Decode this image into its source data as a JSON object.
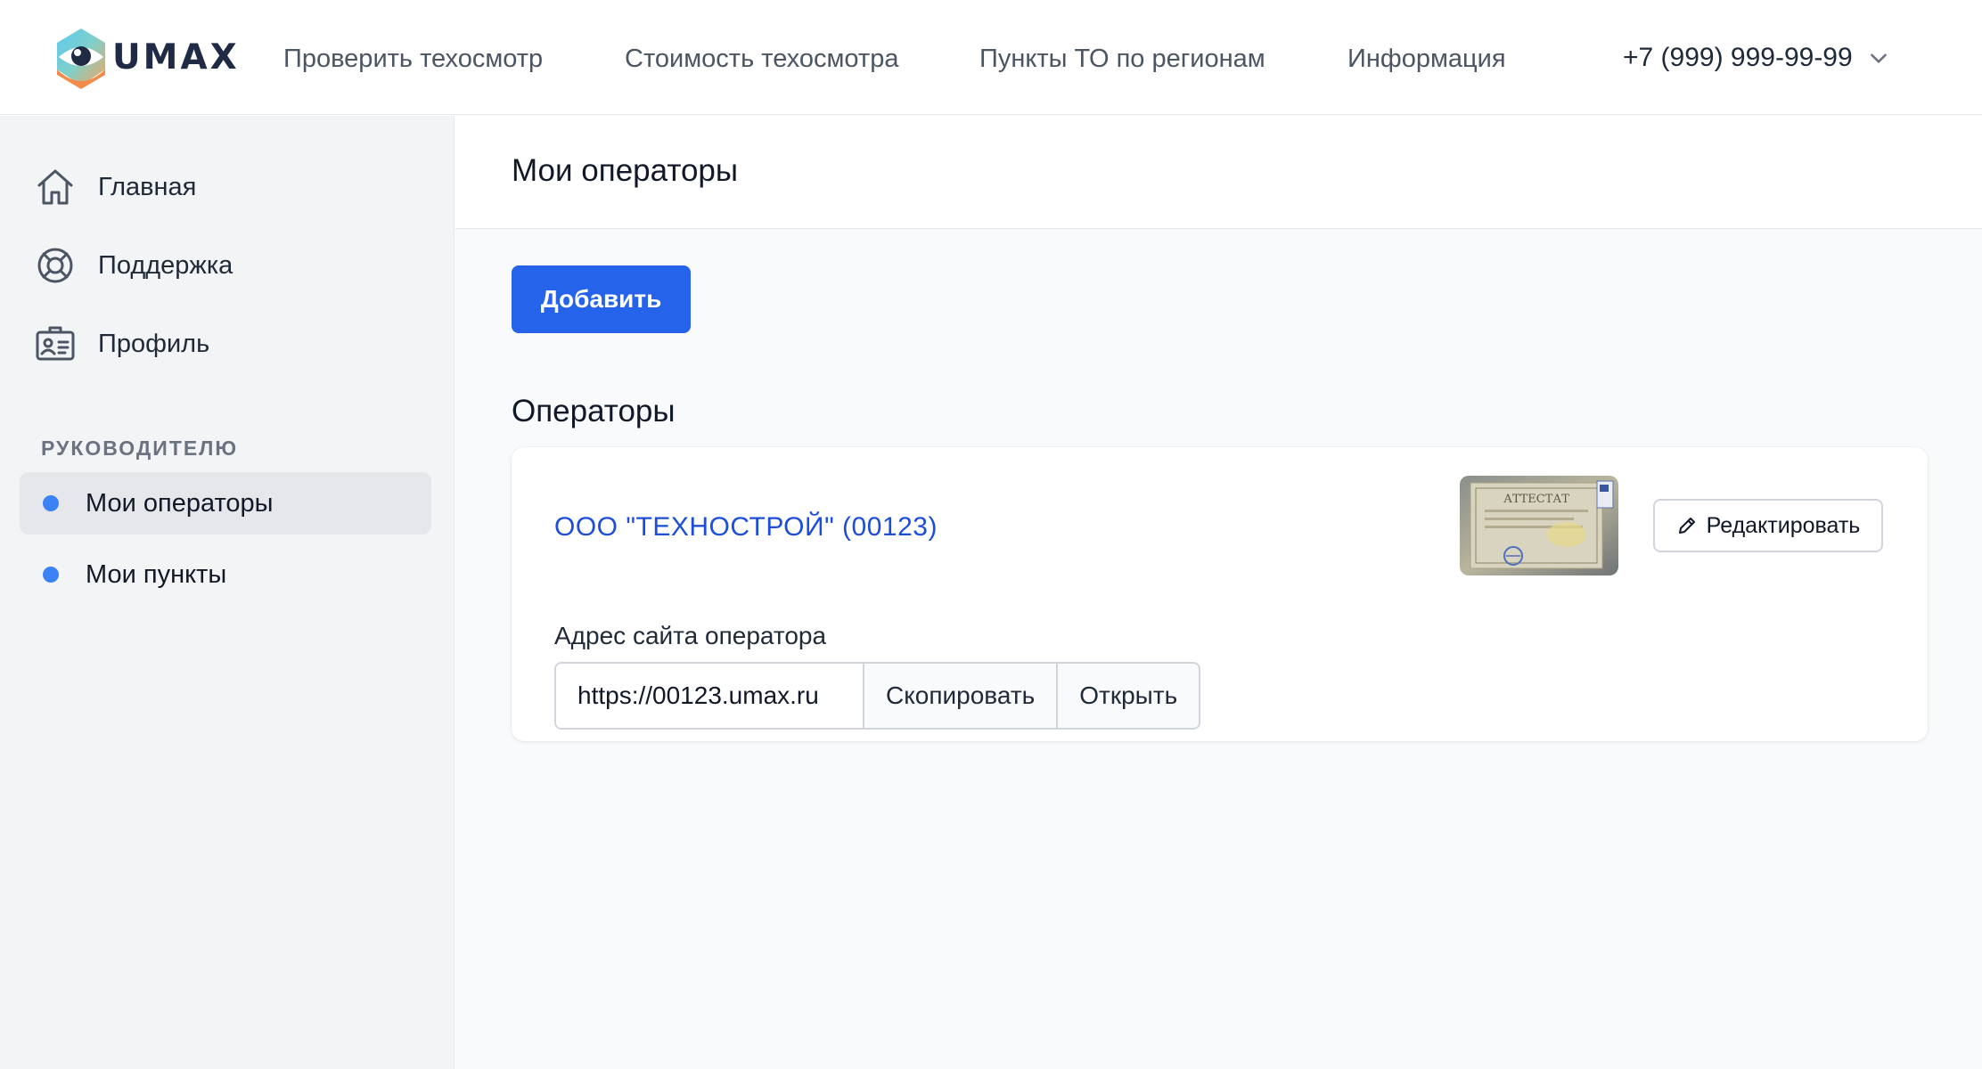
{
  "header": {
    "logo_text": "UMAX",
    "nav": [
      {
        "label": "Проверить техосмотр"
      },
      {
        "label": "Стоимость техосмотра"
      },
      {
        "label": "Пункты ТО по регионам"
      },
      {
        "label": "Информация"
      }
    ],
    "phone": "+7 (999) 999-99-99"
  },
  "sidebar": {
    "items": [
      {
        "label": "Главная",
        "icon": "home-icon"
      },
      {
        "label": "Поддержка",
        "icon": "lifebuoy-icon"
      },
      {
        "label": "Профиль",
        "icon": "id-card-icon"
      }
    ],
    "section_label": "РУКОВОДИТЕЛЮ",
    "sub_items": [
      {
        "label": "Мои операторы",
        "active": true
      },
      {
        "label": "Мои пункты",
        "active": false
      }
    ]
  },
  "main": {
    "page_title": "Мои операторы",
    "add_button": "Добавить",
    "section_title": "Операторы",
    "operator": {
      "name": "ООО \"ТЕХНОСТРОЙ\" (00123)",
      "certificate_text": "АТТЕСТАТ",
      "edit_button": "Редактировать",
      "site_label": "Адрес сайта оператора",
      "site_url": "https://00123.umax.ru",
      "copy_button": "Скопировать",
      "open_button": "Открыть"
    }
  },
  "colors": {
    "accent": "#2563eb",
    "link": "#1d4ed8",
    "dot": "#3b82f6"
  }
}
